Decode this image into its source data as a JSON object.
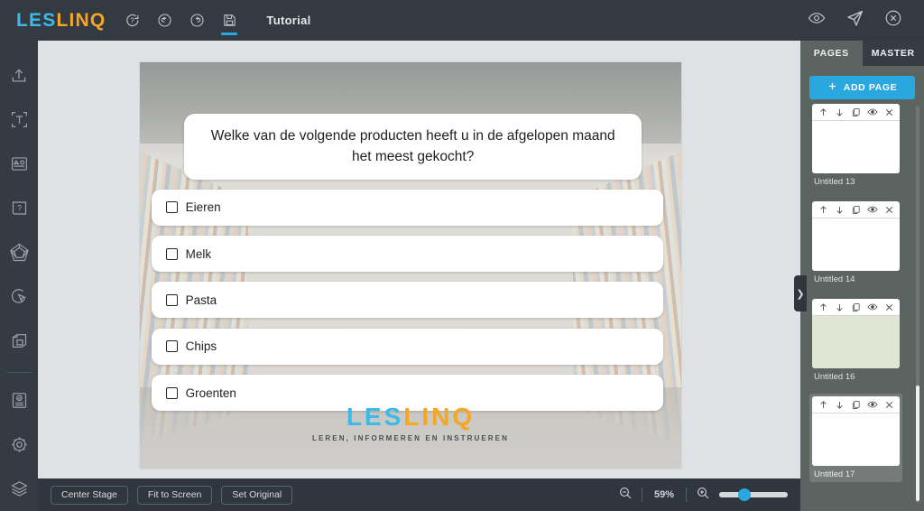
{
  "app": {
    "logo_text_a": "LES",
    "logo_text_b": "LINQ",
    "tutorial_tab": "Tutorial"
  },
  "topbar": {
    "icons": [
      {
        "name": "help-icon",
        "label": "Help"
      },
      {
        "name": "undo-icon",
        "label": "Undo"
      },
      {
        "name": "redo-icon",
        "label": "Redo"
      },
      {
        "name": "save-icon",
        "label": "Save"
      }
    ],
    "right_icons": [
      {
        "name": "preview-eye-icon",
        "label": "Preview"
      },
      {
        "name": "publish-send-icon",
        "label": "Publish"
      },
      {
        "name": "close-icon",
        "label": "Close"
      }
    ]
  },
  "sidebar": {
    "items": [
      {
        "name": "upload-icon",
        "label": "Upload"
      },
      {
        "name": "text-icon",
        "label": "Text"
      },
      {
        "name": "shapes-icon",
        "label": "Shapes"
      },
      {
        "name": "question-icon",
        "label": "Question"
      },
      {
        "name": "star-polygon-icon",
        "label": "Interactions"
      },
      {
        "name": "hotspot-icon",
        "label": "Hotspot"
      },
      {
        "name": "library-icon",
        "label": "Library"
      }
    ],
    "bottom_items": [
      {
        "name": "assessment-icon",
        "label": "Assessment"
      },
      {
        "name": "settings-gear-icon",
        "label": "Settings"
      },
      {
        "name": "layers-icon",
        "label": "Layers"
      }
    ]
  },
  "slide": {
    "question": "Welke van de volgende producten heeft u in de afgelopen maand het meest gekocht?",
    "options": [
      {
        "label": "Eieren",
        "checked": false
      },
      {
        "label": "Melk",
        "checked": false
      },
      {
        "label": "Pasta",
        "checked": false
      },
      {
        "label": "Chips",
        "checked": false
      },
      {
        "label": "Groenten",
        "checked": false
      }
    ],
    "logo_a": "LES",
    "logo_b": "LINQ",
    "tagline": "LEREN, INFORMEREN EN INSTRUEREN"
  },
  "bottombar": {
    "center_stage": "Center Stage",
    "fit_to_screen": "Fit to Screen",
    "set_original": "Set Original",
    "zoom_out_icon": "zoom-out-icon",
    "zoom_in_icon": "zoom-in-icon",
    "zoom_level": "59%"
  },
  "right_panel": {
    "tab_pages": "PAGES",
    "tab_master": "MASTER",
    "active_tab": "PAGES",
    "add_page": "ADD PAGE",
    "thumb_tools": [
      {
        "name": "move-up-icon",
        "glyph": "↑"
      },
      {
        "name": "move-down-icon",
        "glyph": "↓"
      },
      {
        "name": "duplicate-icon",
        "glyph": "❐"
      },
      {
        "name": "visibility-eye-icon",
        "glyph": "◉"
      },
      {
        "name": "delete-icon",
        "glyph": "✕"
      }
    ],
    "pages": [
      {
        "label": "Untitled 13",
        "color": "#ffffff",
        "selected": false
      },
      {
        "label": "Untitled 14",
        "color": "#ffffff",
        "selected": false
      },
      {
        "label": "Untitled 16",
        "color": "#dfe7d4",
        "selected": false
      },
      {
        "label": "Untitled 17",
        "color": "#ffffff",
        "selected": true
      }
    ]
  },
  "colors": {
    "brand_blue": "#29a8e0",
    "brand_orange": "#f5a623",
    "topbar_bg": "#333a41",
    "panel_bg": "#5b6461",
    "canvas_bg": "#dfe2e4"
  }
}
